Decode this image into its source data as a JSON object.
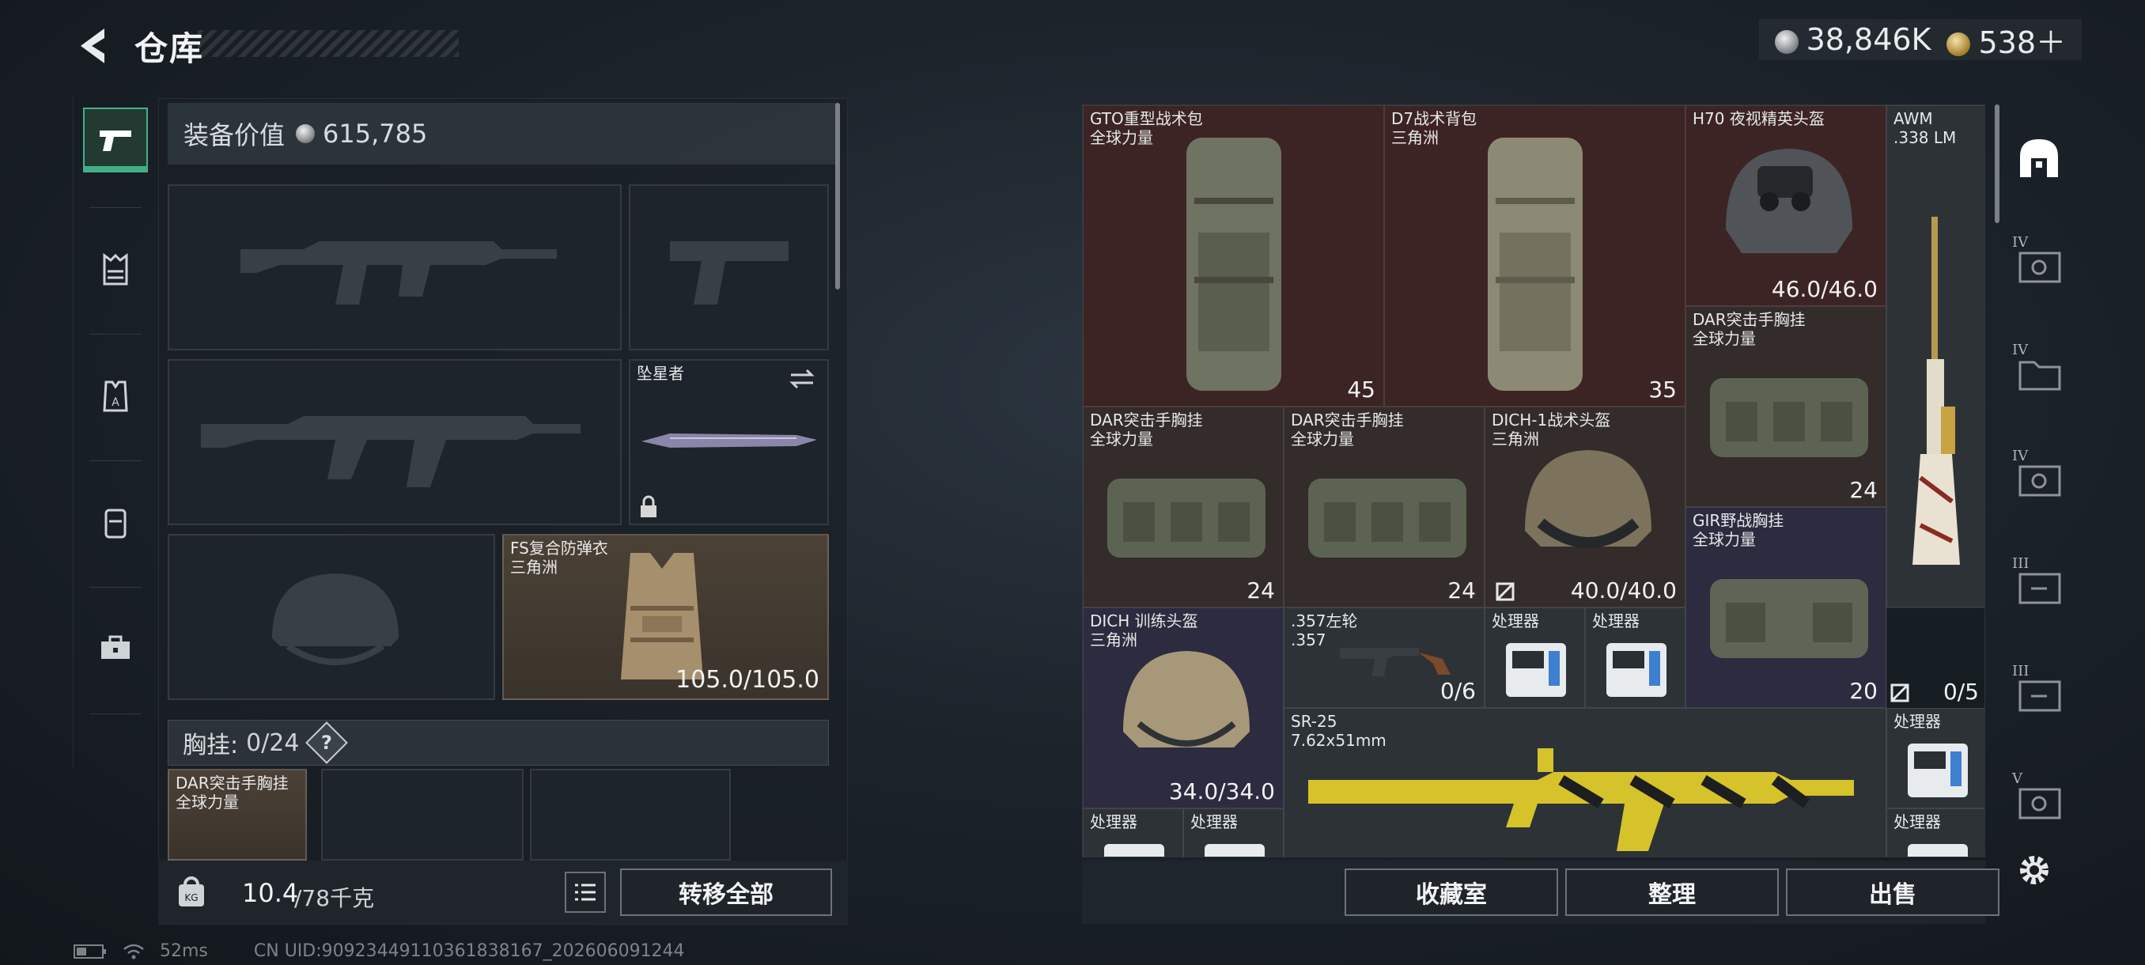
{
  "header": {
    "title": "仓库",
    "currency_silver": "38,846K",
    "currency_gold": "538＋"
  },
  "equipment": {
    "value_label": "装备价值",
    "value": "615,785",
    "melee_label": "坠星者",
    "armor_name": "FS复合防弹衣",
    "armor_source": "三角洲",
    "armor_durability": "105.0/105.0",
    "chest_label": "胸挂:",
    "chest_capacity": "0/24",
    "chest_help": "?",
    "chest_item_name": "DAR突击手胸挂",
    "chest_item_source": "全球力量",
    "weight_current": "10.4",
    "weight_max": "/78千克",
    "transfer_all": "转移全部"
  },
  "stash": {
    "items": [
      {
        "name": "GTO重型战术包",
        "source": "全球力量",
        "value": "45"
      },
      {
        "name": "D7战术背包",
        "source": "三角洲",
        "value": "35"
      },
      {
        "name": "H70 夜视精英头盔",
        "source": "",
        "value": "46.0/46.0"
      },
      {
        "name": "AWM",
        "source": ".338 LM",
        "value": ""
      },
      {
        "name": "DAR突击手胸挂",
        "source": "全球力量",
        "value": "24"
      },
      {
        "name": "DAR突击手胸挂",
        "source": "全球力量",
        "value": "24"
      },
      {
        "name": "DAR突击手胸挂",
        "source": "全球力量",
        "value": "24"
      },
      {
        "name": "DICH-1战术头盔",
        "source": "三角洲",
        "value": "40.0/40.0"
      },
      {
        "name": "GIR野战胸挂",
        "source": "全球力量",
        "value": "20"
      },
      {
        "name": "DICH 训练头盔",
        "source": "三角洲",
        "value": "34.0/34.0"
      },
      {
        "name": ".357左轮",
        "source": ".357",
        "value": "0/6"
      },
      {
        "name": "处理器",
        "source": "",
        "value": ""
      },
      {
        "name": "处理器",
        "source": "",
        "value": ""
      },
      {
        "name": "",
        "source": "",
        "value": "0/5"
      },
      {
        "name": "SR-25",
        "source": "7.62x51mm",
        "value": ""
      },
      {
        "name": "处理器",
        "source": "",
        "value": ""
      },
      {
        "name": "处理器",
        "source": "",
        "value": ""
      },
      {
        "name": "处理器",
        "source": "",
        "value": ""
      },
      {
        "name": "处理器",
        "source": "",
        "value": ""
      }
    ],
    "buttons": {
      "collection": "收藏室",
      "sort": "整理",
      "sell": "出售"
    }
  },
  "rail": {
    "tiers": [
      "IV",
      "IV",
      "IV",
      "III",
      "III",
      "V"
    ]
  },
  "status": {
    "ping": "52ms",
    "uid": "CN UID:9092344911036183816​7_202606091244"
  }
}
